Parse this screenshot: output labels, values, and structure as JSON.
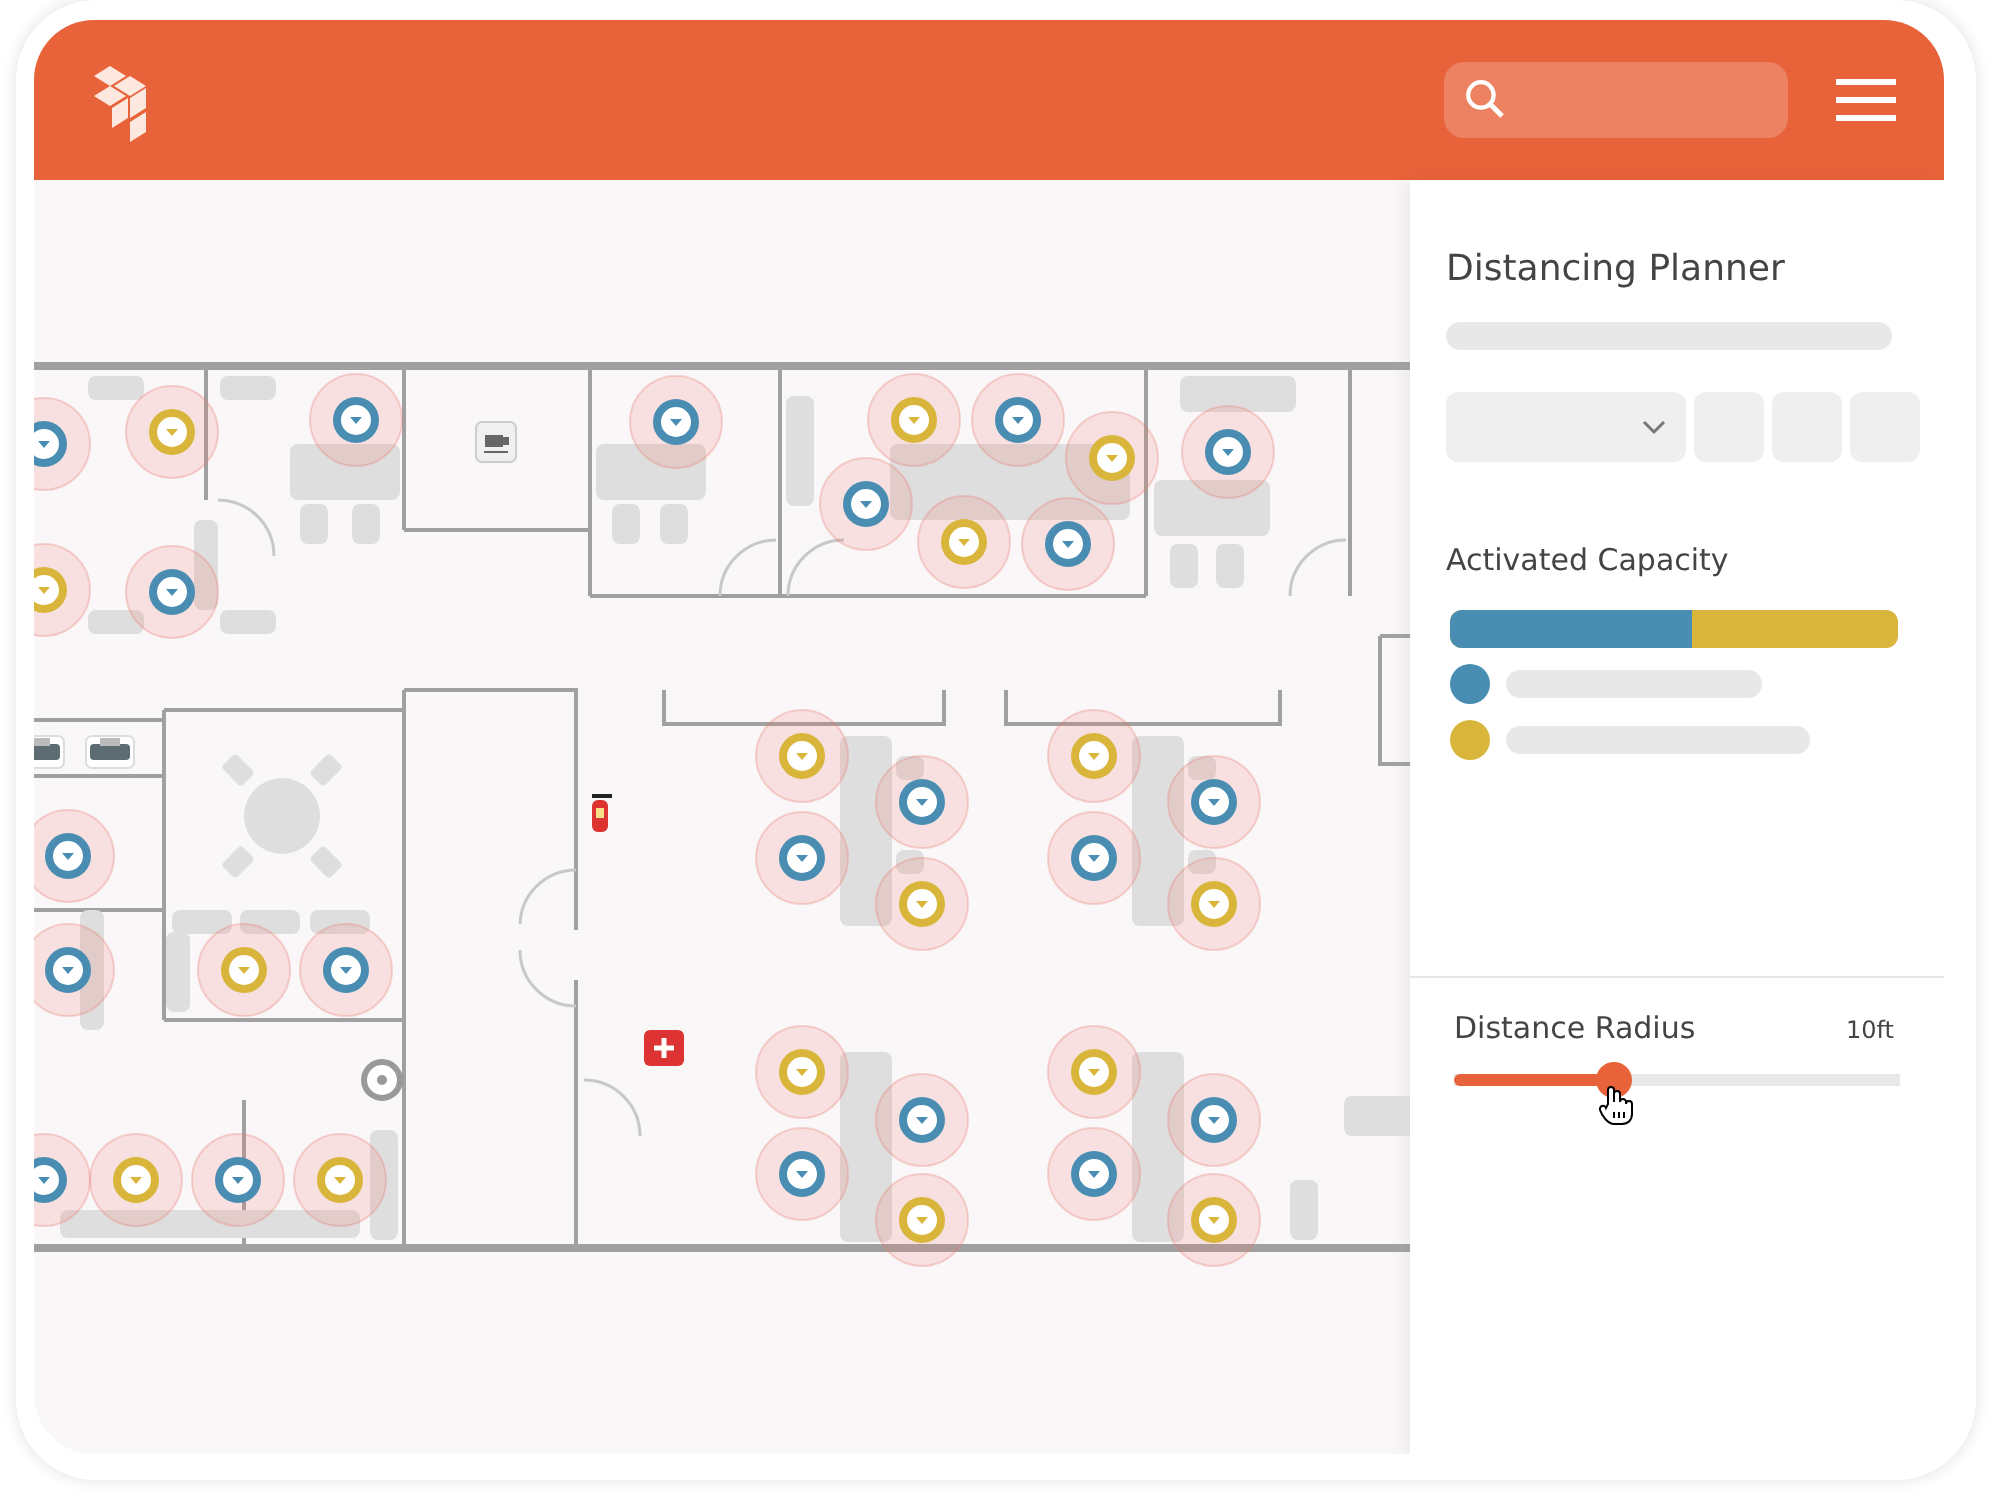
{
  "panel": {
    "title": "Distancing Planner",
    "capacity": {
      "title": "Activated Capacity",
      "level": 0.54,
      "legend": [
        {
          "color": "#4a8db3"
        },
        {
          "color": "#d9b63b"
        }
      ]
    },
    "radius": {
      "label": "Distance Radius",
      "reading": "10ft",
      "level": 0.36
    }
  }
}
